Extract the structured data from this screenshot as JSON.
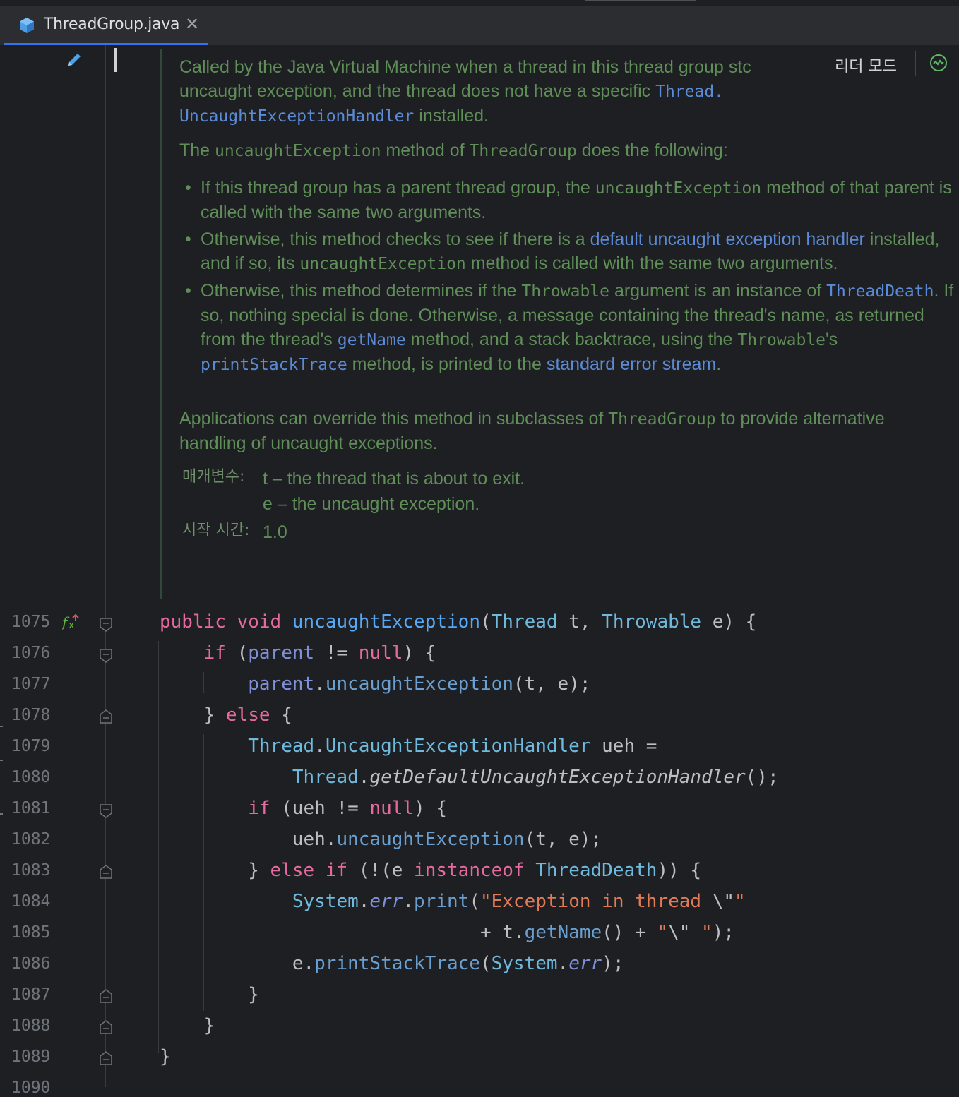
{
  "tab": {
    "filename": "ThreadGroup.java",
    "icon": "java-class-icon",
    "close_glyph": "✕"
  },
  "reader_mode": {
    "label": "리더 모드"
  },
  "doc": {
    "p1": [
      {
        "t": "Called by the Java Virtual Machine when a thread in this thread group stops because of an ",
        "s": "text"
      },
      {
        "t": "uncaught exception, and the thread does not have a specific ",
        "s": "text"
      },
      {
        "t": "Thread.",
        "s": "code-link"
      },
      {
        "t": "UncaughtExceptionHandler",
        "s": "code-link"
      },
      {
        "t": " installed.",
        "s": "text"
      }
    ],
    "p1_line1": "Called by the Java Virtual Machine when a thread in this thread group stc",
    "p1_line2a": "uncaught exception, and the thread does not have a specific ",
    "p1_line2b": "Thread.",
    "p1_line3a": "UncaughtExceptionHandler",
    "p1_line3b": " installed.",
    "p2a": "The ",
    "p2b": "uncaughtException",
    "p2c": " method of ",
    "p2d": "ThreadGroup",
    "p2e": " does the following:",
    "b1a": "If this thread group has a parent thread group, the ",
    "b1b": "uncaughtException",
    "b1c": " method of that parent is called with the same two arguments.",
    "b2a": "Otherwise, this method checks to see if there is a ",
    "b2b": "default uncaught exception handler",
    "b2c": " installed, and if so, its ",
    "b2d": "uncaughtException",
    "b2e": " method is called with the same two arguments.",
    "b3a": "Otherwise, this method determines if the ",
    "b3b": "Throwable",
    "b3c": " argument is an instance of ",
    "b3d": "ThreadDeath",
    "b3e": ". If so, nothing special is done. Otherwise, a message containing the thread's name, as returned from the thread's ",
    "b3f": "getName",
    "b3g": " method, and a stack backtrace, using the ",
    "b3h": "Throwable",
    "b3i": "'s ",
    "b3j": "printStackTrace",
    "b3k": " method, is printed to the ",
    "b3l": "standard error stream",
    "b3m": ".",
    "p3a": "Applications can override this method in subclasses of ",
    "p3b": "ThreadGroup",
    "p3c": " to provide alternative handling of uncaught exceptions.",
    "params_label": "매개변수:",
    "param_t": "t – the thread that is about to exit.",
    "param_e": "e – the uncaught exception.",
    "since_label": "시작 시간:",
    "since_value": "1.0"
  },
  "line_numbers": [
    "1075",
    "1076",
    "1077",
    "1078",
    "1079",
    "1080",
    "1081",
    "1082",
    "1083",
    "1084",
    "1085",
    "1086",
    "1087",
    "1088",
    "1089",
    "1090"
  ],
  "colors": {
    "background": "#1e1f22",
    "doc_text": "#5f8e58",
    "link": "#5b8bd6",
    "keyword": "#cf8e6d",
    "tab_accent": "#3574f0"
  },
  "icons": {
    "pencil": "pencil-edit-icon",
    "override": "override-method-icon",
    "inspections": "inspections-ok-icon"
  }
}
